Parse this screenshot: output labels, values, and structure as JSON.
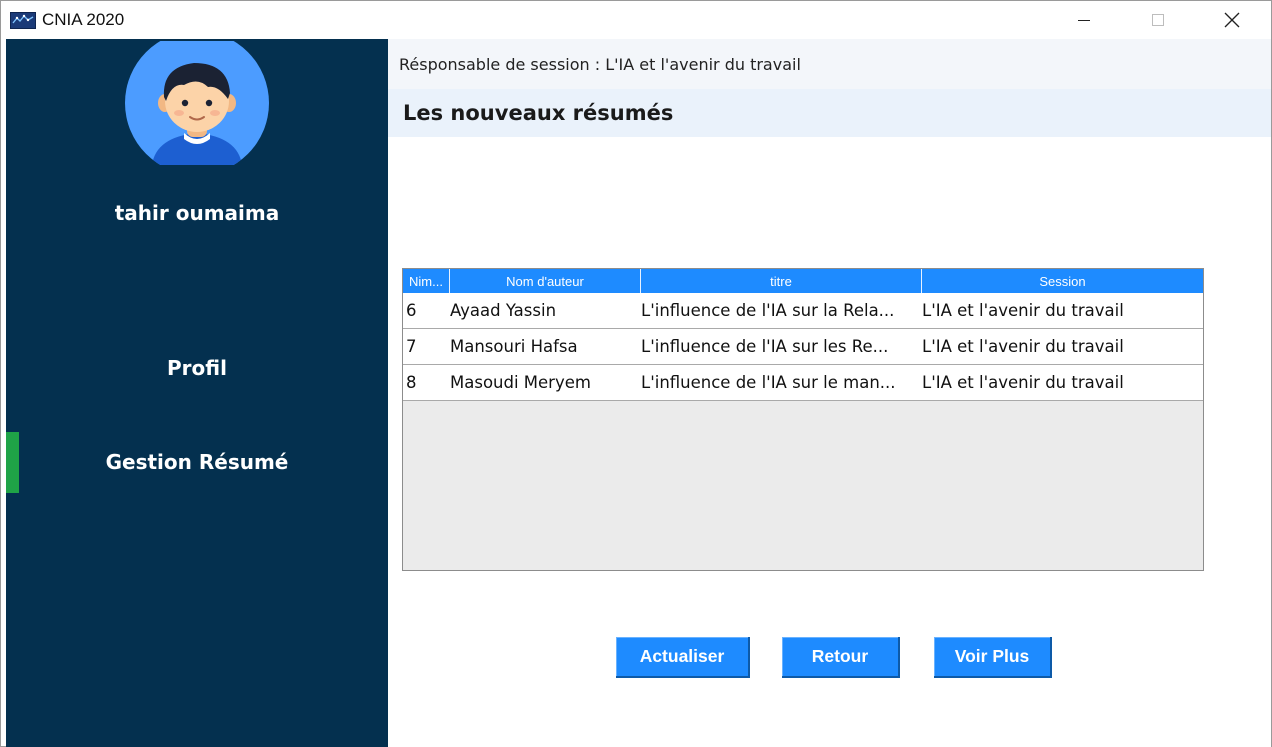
{
  "window": {
    "title": "CNIA 2020",
    "minimize_glyph": "—",
    "maximize_glyph": "☐",
    "close_glyph": "✕"
  },
  "sidebar": {
    "username": "tahir oumaima",
    "items": [
      {
        "label": "Profil",
        "active": false
      },
      {
        "label": "Gestion Résumé",
        "active": true
      }
    ],
    "bg_color": "#04304f",
    "active_indicator_color": "#1fa347"
  },
  "main": {
    "session_line": "Résponsable de session : L'IA et l'avenir du travail",
    "heading": "Les nouveaux résumés"
  },
  "table": {
    "headers": [
      "Nim...",
      "Nom d'auteur",
      "titre",
      "Session"
    ],
    "rows": [
      [
        "6",
        "Ayaad Yassin",
        "L'influence de l'IA sur la Rela...",
        "L'IA et l'avenir du travail"
      ],
      [
        "7",
        "Mansouri Hafsa",
        "L'influence de l'IA sur les Re...",
        "L'IA et l'avenir du travail"
      ],
      [
        "8",
        "Masoudi Meryem",
        "L'influence de l'IA sur le man...",
        "L'IA et l'avenir du travail"
      ]
    ],
    "header_color": "#1e8bff"
  },
  "buttons": {
    "actualiser": "Actualiser",
    "retour": "Retour",
    "voir_plus": "Voir Plus",
    "color": "#1e8bff"
  },
  "icons": {
    "app": "app-logo-icon",
    "avatar": "user-avatar-icon"
  }
}
